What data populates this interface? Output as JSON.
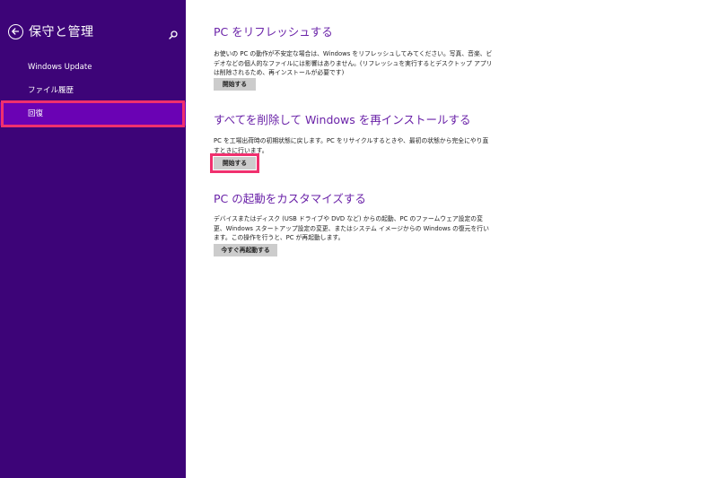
{
  "sidebar": {
    "title": "保守と管理",
    "items": [
      {
        "label": "Windows Update"
      },
      {
        "label": "ファイル履歴"
      },
      {
        "label": "回復"
      }
    ]
  },
  "sections": [
    {
      "title": "PC をリフレッシュする",
      "description": "お使いの PC の動作が不安定な場合は、Windows をリフレッシュしてみてください。写真、音楽、ビデオなどの個人的なファイルには影響はありません。(リフレッシュを実行するとデスクトップ アプリは削除されるため、再インストールが必要です)",
      "button": "開始する"
    },
    {
      "title": "すべてを削除して Windows を再インストールする",
      "description": "PC を工場出荷時の初期状態に戻します。PC をリサイクルするときや、最初の状態から完全にやり直すときに行います。",
      "button": "開始する"
    },
    {
      "title": "PC の起動をカスタマイズする",
      "description": "デバイスまたはディスク (USB ドライブや DVD など) からの起動、PC のファームウェア設定の変更、Windows スタートアップ設定の変更、またはシステム イメージからの Windows の復元を行います。この操作を行うと、PC が再起動します。",
      "button": "今すぐ再起動する"
    }
  ],
  "colors": {
    "sidebar_bg": "#3d0478",
    "selected_bg": "#6a02b4",
    "accent_title": "#6a22a8",
    "highlight": "#f0306e",
    "button_bg": "#cccccc"
  },
  "icons": {
    "back": "back-arrow-circle-icon",
    "search": "search-icon"
  }
}
